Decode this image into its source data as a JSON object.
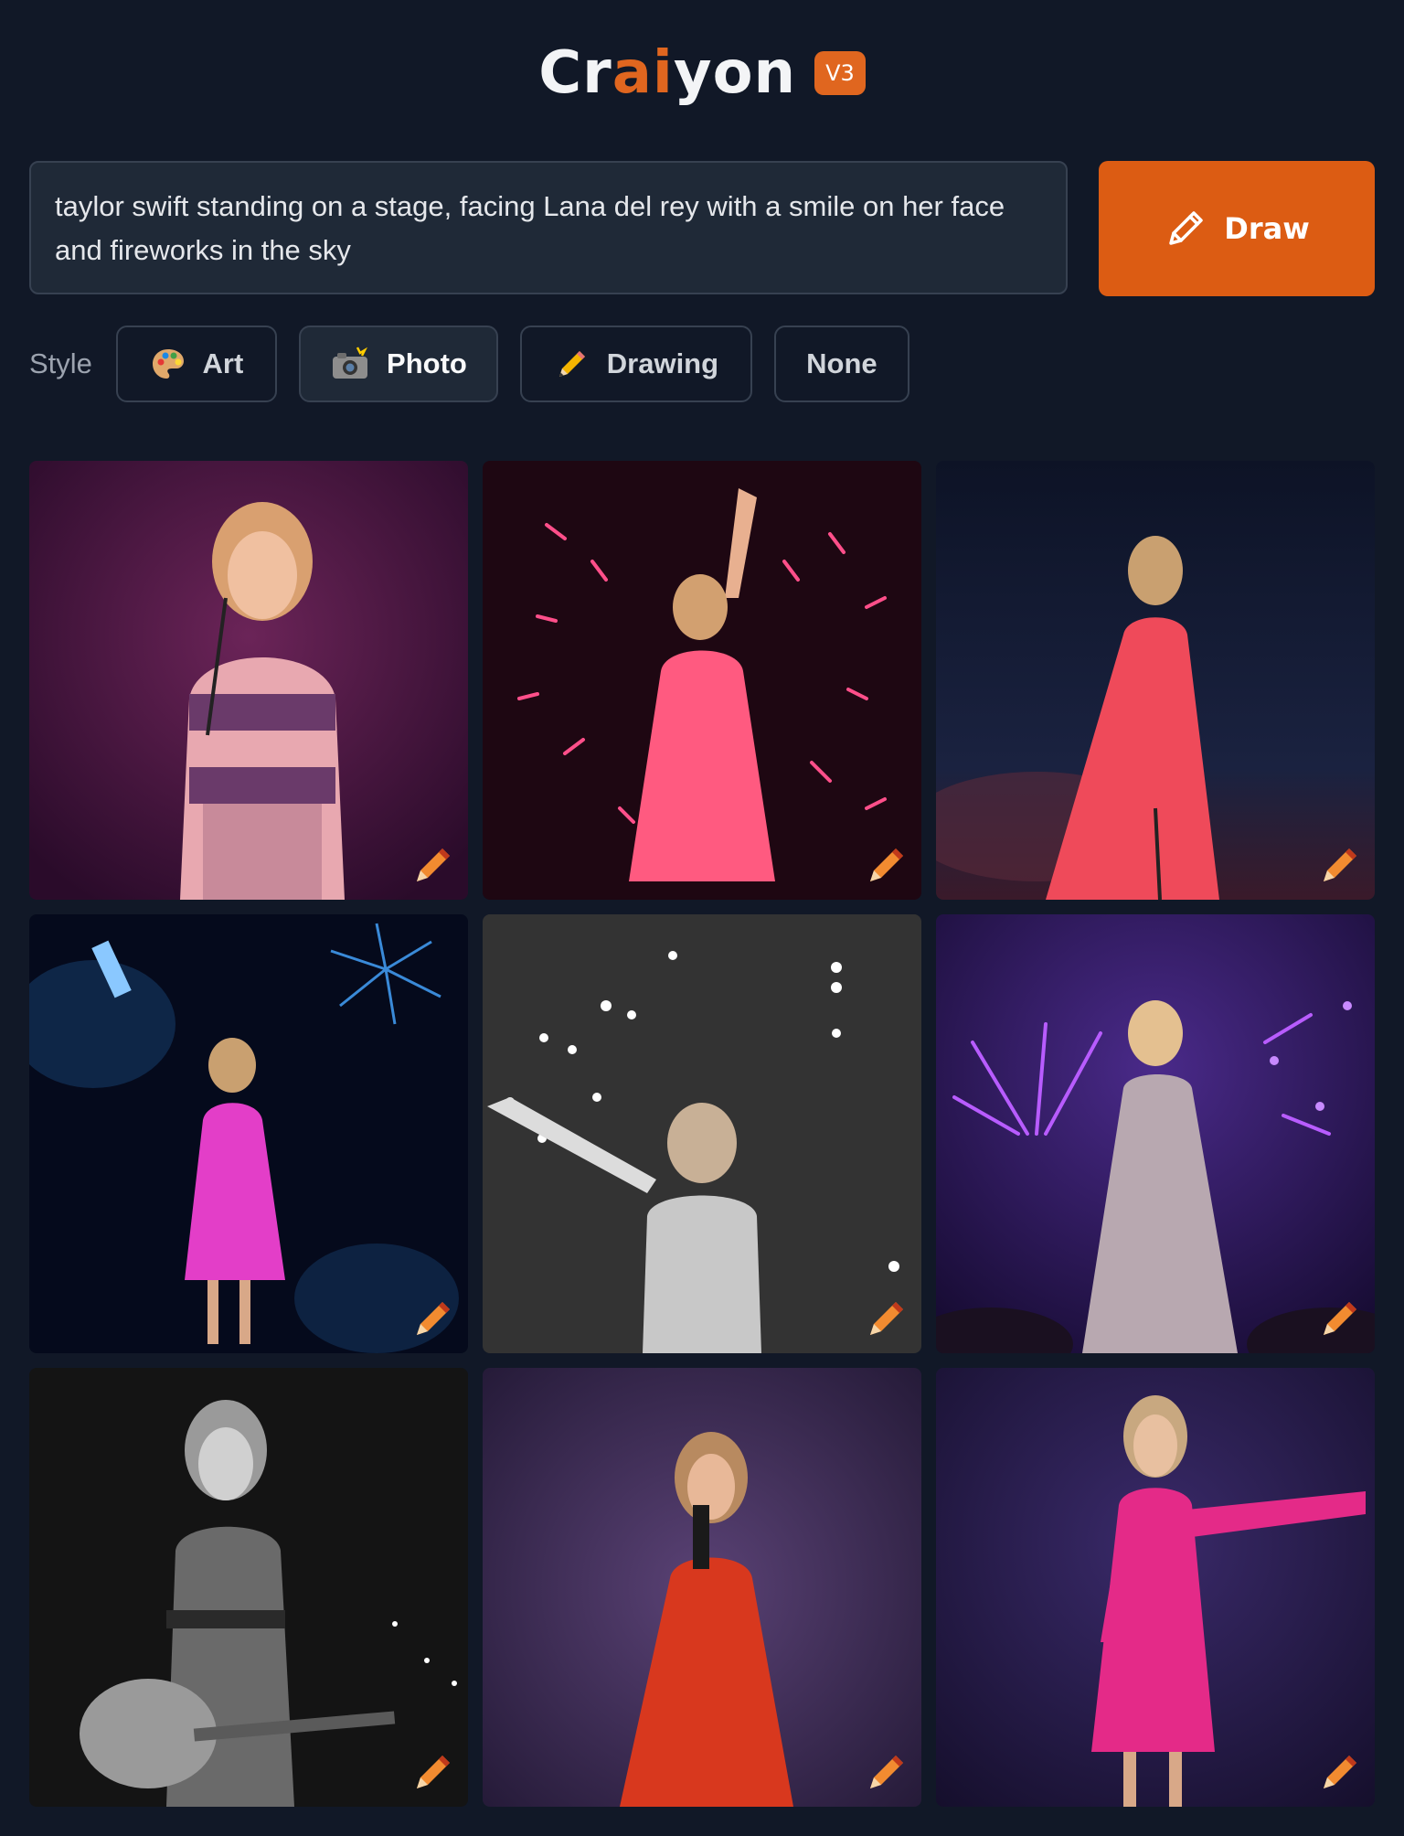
{
  "header": {
    "logo_part1": "Cr",
    "logo_accent1": "a",
    "logo_accent2": "i",
    "logo_part2": "yon",
    "version": "V3"
  },
  "prompt": {
    "text": "taylor swift standing on a stage, facing Lana del rey with a smile on her face and fireworks in the sky"
  },
  "draw_button": {
    "label": "Draw",
    "icon": "pencil-icon"
  },
  "style": {
    "label": "Style",
    "options": [
      {
        "label": "Art",
        "icon": "palette-icon",
        "active": false
      },
      {
        "label": "Photo",
        "icon": "camera-flash-icon",
        "active": true
      },
      {
        "label": "Drawing",
        "icon": "pencil-emoji-icon",
        "active": false
      },
      {
        "label": "None",
        "icon": "",
        "active": false
      }
    ]
  },
  "colors": {
    "background": "#111827",
    "accent": "#dc5c13",
    "panel": "#1f2937"
  },
  "images": [
    {
      "palette": [
        "#3a1038",
        "#6b2458",
        "#c77f9a"
      ],
      "description_icon": "image"
    },
    {
      "palette": [
        "#1a0610",
        "#3b0d1f",
        "#ff3f7a"
      ],
      "description_icon": "image"
    },
    {
      "palette": [
        "#0c1226",
        "#1b2240",
        "#e8394f"
      ],
      "description_icon": "image"
    },
    {
      "palette": [
        "#060a1c",
        "#0f1a3a",
        "#e23fc6"
      ],
      "description_icon": "image"
    },
    {
      "palette": [
        "#2c2c2c",
        "#3a3a3a",
        "#d9d9d9"
      ],
      "description_icon": "image"
    },
    {
      "palette": [
        "#1a0f3a",
        "#3a2270",
        "#c9a7b8"
      ],
      "description_icon": "image"
    },
    {
      "palette": [
        "#0e0e0e",
        "#1c1c1c",
        "#bdbdbd"
      ],
      "description_icon": "image"
    },
    {
      "palette": [
        "#1e1530",
        "#3b2a56",
        "#e0442a"
      ],
      "description_icon": "image"
    },
    {
      "palette": [
        "#1a1236",
        "#2d1f5a",
        "#e8288f"
      ],
      "description_icon": "image"
    }
  ]
}
